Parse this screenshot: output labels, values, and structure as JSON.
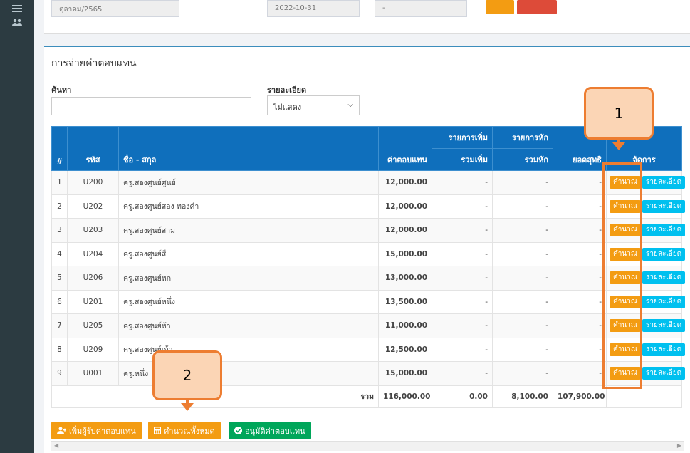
{
  "top_card": {
    "field1": "ตุลาคม/2565",
    "field2": "2022-10-31",
    "field3": "-",
    "btn1_color": "#f39c12",
    "btn2_color": "#dd4b39"
  },
  "panel": {
    "title": "การจ่ายค่าตอบแทน",
    "search_label": "ค้นหา",
    "search_placeholder": "",
    "detail_label": "รายละเอียด",
    "detail_selected": "ไม่แสดง"
  },
  "table": {
    "headers": {
      "no": "#",
      "code": "รหัส",
      "name": "ชื่อ - สกุล",
      "pay": "ค่าตอบแทน",
      "add_group": "รายการเพิ่ม",
      "add_total": "รวมเพิ่ม",
      "deduct_group": "รายการหัก",
      "deduct_total": "รวมหัก",
      "net": "ยอดสุทธิ",
      "actions": "จัดการ"
    },
    "rows": [
      {
        "no": "1",
        "code": "U200",
        "name": "ครู.สองศูนย์ศูนย์",
        "pay": "12,000.00",
        "add": "-",
        "deduct": "-",
        "net": "-"
      },
      {
        "no": "2",
        "code": "U202",
        "name": "ครู.สองศูนย์สอง ทองคำ",
        "pay": "12,000.00",
        "add": "-",
        "deduct": "-",
        "net": "-"
      },
      {
        "no": "3",
        "code": "U203",
        "name": "ครู.สองศูนย์สาม",
        "pay": "12,000.00",
        "add": "-",
        "deduct": "-",
        "net": "-"
      },
      {
        "no": "4",
        "code": "U204",
        "name": "ครู.สองศูนย์สี่",
        "pay": "15,000.00",
        "add": "-",
        "deduct": "-",
        "net": "-"
      },
      {
        "no": "5",
        "code": "U206",
        "name": "ครู.สองศูนย์หก",
        "pay": "13,000.00",
        "add": "-",
        "deduct": "-",
        "net": "-"
      },
      {
        "no": "6",
        "code": "U201",
        "name": "ครู.สองศูนย์หนึ่ง",
        "pay": "13,500.00",
        "add": "-",
        "deduct": "-",
        "net": "-"
      },
      {
        "no": "7",
        "code": "U205",
        "name": "ครู.สองศูนย์ห้า",
        "pay": "11,000.00",
        "add": "-",
        "deduct": "-",
        "net": "-"
      },
      {
        "no": "8",
        "code": "U209",
        "name": "ครู.สองศูนย์เก้า",
        "pay": "12,500.00",
        "add": "-",
        "deduct": "-",
        "net": "-"
      },
      {
        "no": "9",
        "code": "U001",
        "name": "ครู.หนึ่ง",
        "pay": "15,000.00",
        "add": "-",
        "deduct": "-",
        "net": "-"
      }
    ],
    "calc_label": "คำนวณ",
    "detail_btn_label": "รายละเอียด",
    "footer": {
      "label": "รวม",
      "pay": "116,000.00",
      "add": "0.00",
      "deduct": "8,100.00",
      "net": "107,900.00"
    }
  },
  "buttons": {
    "add_recipient": "เพิ่มผู้รับค่าตอบแทน",
    "calc_all": "คำนวณทั้งหมด",
    "approve": "อนุมัติค่าตอบแทน"
  },
  "callouts": {
    "one": "1",
    "two": "2"
  },
  "colors": {
    "header_blue": "#0f6fbc",
    "orange": "#f39c12",
    "cyan": "#00c0ef",
    "green": "#00a65a",
    "annotation": "#ed7d31"
  },
  "icons": {
    "sidebar1": "menu-icon",
    "sidebar2": "users-icon",
    "add_recipient": "user-plus-icon",
    "calc_all": "calculator-icon",
    "approve": "check-circle-icon"
  }
}
